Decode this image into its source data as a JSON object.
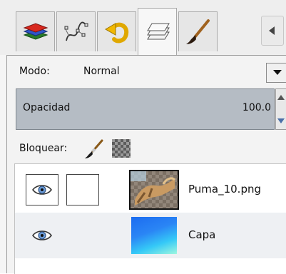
{
  "tabs": [
    {
      "name": "layers-stack-icon",
      "active": false
    },
    {
      "name": "paths-icon",
      "active": false
    },
    {
      "name": "undo-history-icon",
      "active": false
    },
    {
      "name": "layers-pages-icon",
      "active": true
    },
    {
      "name": "paintbrush-icon",
      "active": false
    }
  ],
  "layers_panel": {
    "mode_label": "Modo:",
    "mode_value": "Normal",
    "opacity_label": "Opacidad",
    "opacity_value": "100.0",
    "lock_label": "Bloquear:",
    "layers": [
      {
        "name": "Puma_10.png",
        "visible": true,
        "thumbnail": "image-thumbnail"
      },
      {
        "name": "Capa",
        "visible": true,
        "thumbnail": "gradient-thumbnail"
      }
    ]
  },
  "colors": {
    "opacity_bar": "#b5bcc4",
    "gradient_blue": "#1c6cf0",
    "gradient_cyan": "#35c9f7",
    "selected_row": "#eef0f3"
  }
}
